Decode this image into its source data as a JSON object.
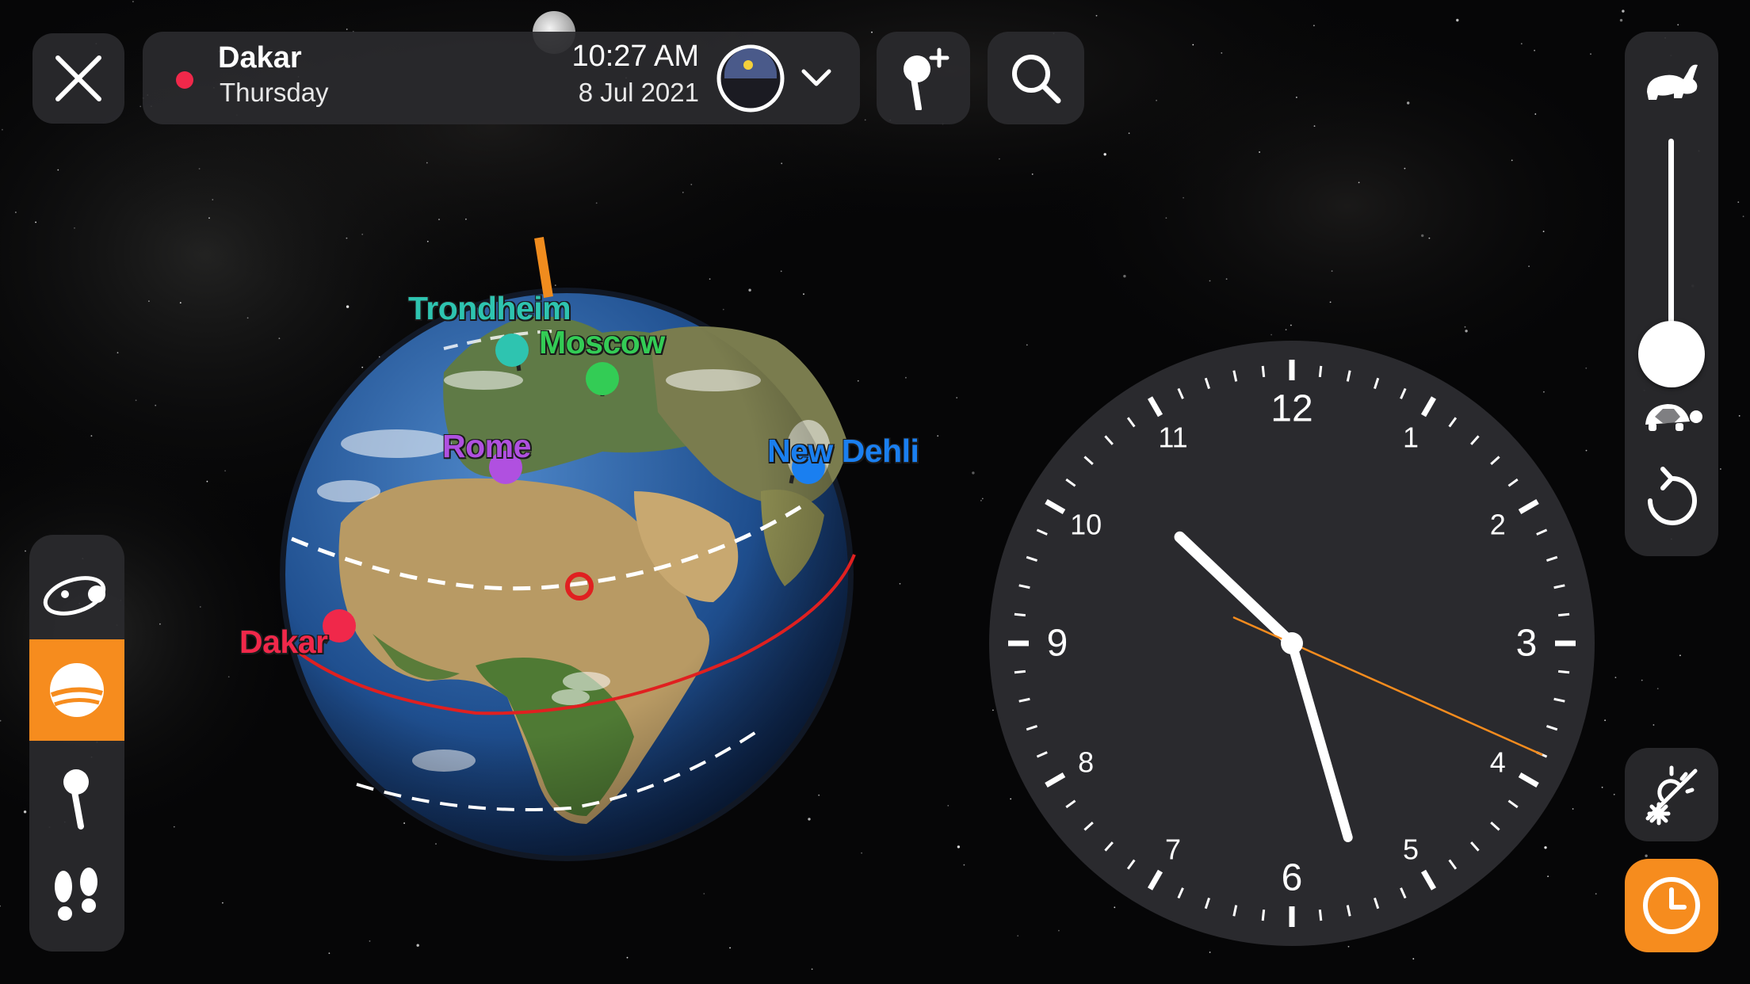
{
  "location": {
    "city": "Dakar",
    "day": "Thursday",
    "time": "10:27 AM",
    "date": "8 Jul 2021",
    "dot_color": "#f0284a"
  },
  "toolbar": {
    "close_icon": "close-icon",
    "moon_phase_icon": "moon-phase-dial-icon",
    "expand_icon": "chevron-down-icon",
    "add_pin_icon": "add-pin-icon",
    "search_icon": "search-icon"
  },
  "speed_control": {
    "fast_icon": "rabbit-icon",
    "slow_icon": "turtle-icon",
    "reset_icon": "reset-icon",
    "level": 0.0
  },
  "left_toolbar": {
    "items": [
      {
        "icon": "orbit-icon",
        "active": false
      },
      {
        "icon": "planet-icon",
        "active": true
      },
      {
        "icon": "pin-icon",
        "active": false
      },
      {
        "icon": "footsteps-icon",
        "active": false
      }
    ]
  },
  "right_buttons": {
    "climate_icon": "sun-snow-icon",
    "clock_icon": "clock-icon"
  },
  "globe": {
    "cities": [
      {
        "name": "Trondheim",
        "color": "#2ec4b0"
      },
      {
        "name": "Moscow",
        "color": "#33cc55"
      },
      {
        "name": "Rome",
        "color": "#b050e0"
      },
      {
        "name": "New Dehli",
        "color": "#1a7ff0"
      },
      {
        "name": "Dakar",
        "color": "#f0284a"
      }
    ]
  },
  "clock": {
    "numerals": [
      "12",
      "1",
      "2",
      "3",
      "4",
      "5",
      "6",
      "7",
      "8",
      "9",
      "10",
      "11"
    ],
    "hour": 10,
    "minute": 27,
    "second": 19,
    "accent": "#f68c1e"
  },
  "colors": {
    "accent": "#f68c1e",
    "panel": "#2a2a2e"
  }
}
